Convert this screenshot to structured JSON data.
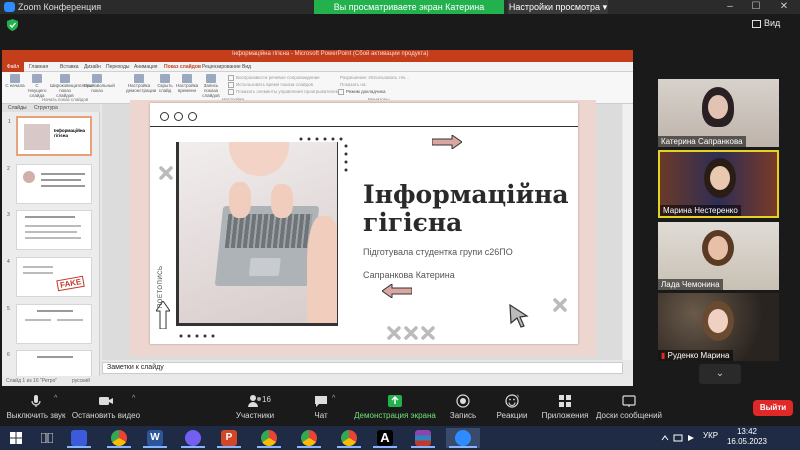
{
  "zoom": {
    "app_title": "Zoom Конференция",
    "share_banner": "Вы просматриваете экран Катерина Сапранкова",
    "view_settings": "Настройки просмотра",
    "view_button": "Вид",
    "colors": {
      "share_green": "#23b14d",
      "end_red": "#e02828",
      "active_speaker": "#e5d321",
      "share_label_green": "#6fe27a"
    }
  },
  "powerpoint": {
    "window_title": "Інформаційна гігієна - Microsoft PowerPoint (Сбой активации продукта)",
    "tabs": [
      "Файл",
      "Главная",
      "Вставка",
      "Дизайн",
      "Переходы",
      "Анимация",
      "Показ слайдов",
      "Рецензирование",
      "Вид"
    ],
    "ribbon": {
      "buttons": [
        "С начала",
        "С текущего слайда",
        "Широковещательный показ слайдов",
        "Произвольный показ",
        "Настройка демонстрации",
        "Скрыть слайд",
        "Настройка времени",
        "Запись показа слайдов"
      ],
      "checks": [
        "Воспроизвести речевое сопровождение",
        "Использовать время показа слайдов",
        "Показать элементы управления проигрывателем"
      ],
      "monitor": [
        "Разрешение: Использовать тек...",
        "Показать на:",
        "Режим докладчика"
      ],
      "groups": [
        "Начать показ слайдов",
        "Настройка",
        "Мониторы"
      ]
    },
    "panel_tabs": [
      "Слайды",
      "Структура"
    ],
    "thumbnails": [
      {
        "num": "1",
        "title": "Інформаційна гігієна"
      },
      {
        "num": "2",
        "title": ""
      },
      {
        "num": "3",
        "title": ""
      },
      {
        "num": "4",
        "title": "FAKE"
      },
      {
        "num": "5",
        "title": ""
      },
      {
        "num": "6",
        "title": ""
      }
    ],
    "notes_placeholder": "Заметки к слайду",
    "status": {
      "slide": "Слайд 1 из 16",
      "theme": "\"Ретро\"",
      "lang": "русский"
    },
    "slide": {
      "title": "Інформаційна гігієна",
      "subtitle": "Підготувала студентка групи с26ПО",
      "author": "Сапранкова Катерина",
      "vertical_text": "ПОЕТОПИСЬ"
    }
  },
  "participants": [
    {
      "name": "Катерина Сапранкова",
      "active": false
    },
    {
      "name": "Марина Нестеренко",
      "active": true
    },
    {
      "name": "Лада Чемонина",
      "active": false
    },
    {
      "name": "Руденко Марина",
      "active": false
    }
  ],
  "toolbar": {
    "mute": "Выключить звук",
    "video": "Остановить видео",
    "participants": "Участники",
    "participants_count": "16",
    "chat": "Чат",
    "share": "Демонстрация экрана",
    "record": "Запись",
    "reactions": "Реакции",
    "apps": "Приложения",
    "whiteboards": "Доски сообщений",
    "end": "Выйти"
  },
  "taskbar": {
    "lang": "УКР",
    "time": "13:42",
    "date": "16.05.2023",
    "apps": [
      {
        "name": "windows-start",
        "color": "#ffffff"
      },
      {
        "name": "task-view",
        "color": "#cccccc"
      },
      {
        "name": "save-disk",
        "color": "#3b5bdb"
      },
      {
        "name": "chrome",
        "color": "#ea4335"
      },
      {
        "name": "word",
        "color": "#2b579a"
      },
      {
        "name": "viber",
        "color": "#7360f2"
      },
      {
        "name": "powerpoint",
        "color": "#d24726"
      },
      {
        "name": "chrome-2",
        "color": "#ea4335"
      },
      {
        "name": "chrome-3",
        "color": "#ea4335"
      },
      {
        "name": "chrome-4",
        "color": "#ea4335"
      },
      {
        "name": "font-a",
        "color": "#000000"
      },
      {
        "name": "winrar",
        "color": "#8e44ad"
      },
      {
        "name": "zoom",
        "color": "#2d8cff"
      }
    ]
  }
}
